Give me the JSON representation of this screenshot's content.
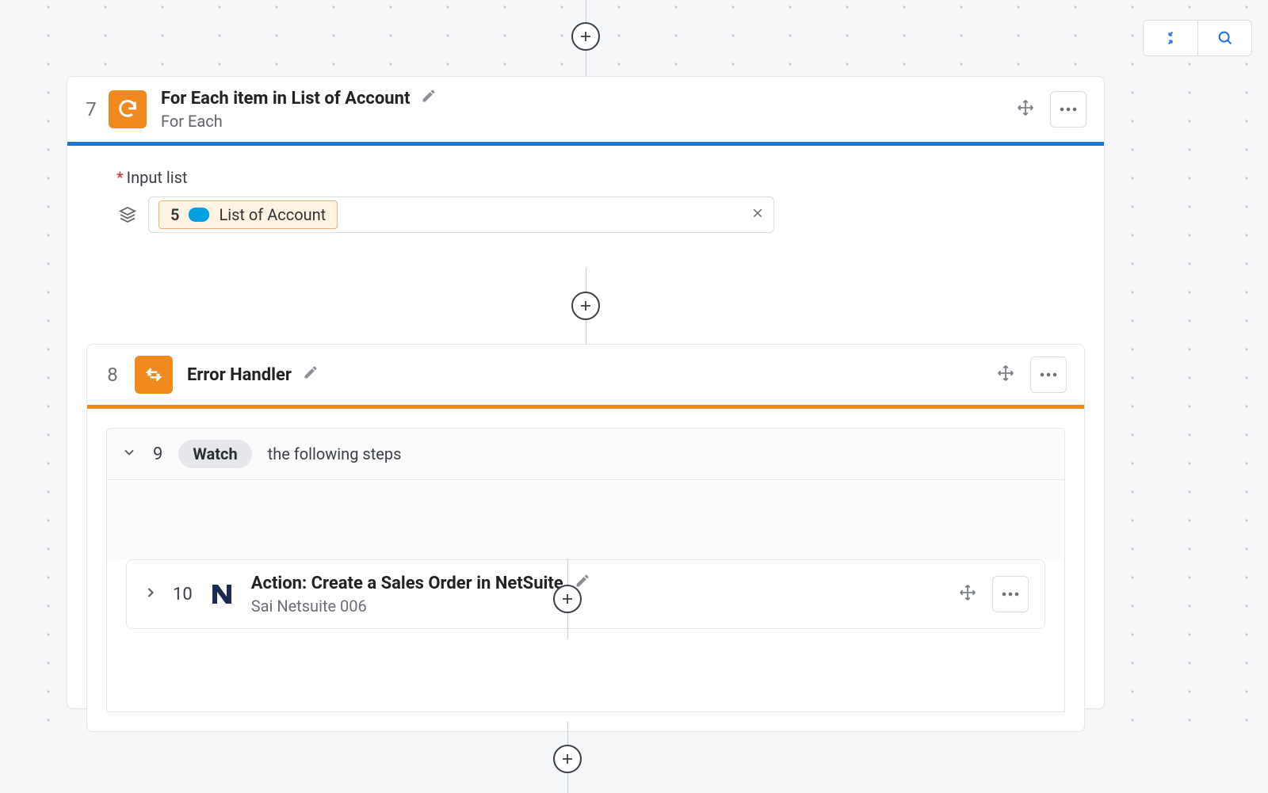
{
  "toolbar": {
    "collapse_tooltip": "Collapse",
    "search_tooltip": "Search"
  },
  "step7": {
    "number": "7",
    "title": "For Each item in List of Account",
    "subtitle": "For Each",
    "input_label": "Input list",
    "pill_step": "5",
    "pill_text": "List of Account"
  },
  "step8": {
    "number": "8",
    "title": "Error Handler"
  },
  "step9": {
    "number": "9",
    "badge": "Watch",
    "text": "the following steps"
  },
  "step10": {
    "number": "10",
    "title": "Action: Create a Sales Order in NetSuite",
    "subtitle": "Sai Netsuite 006"
  }
}
